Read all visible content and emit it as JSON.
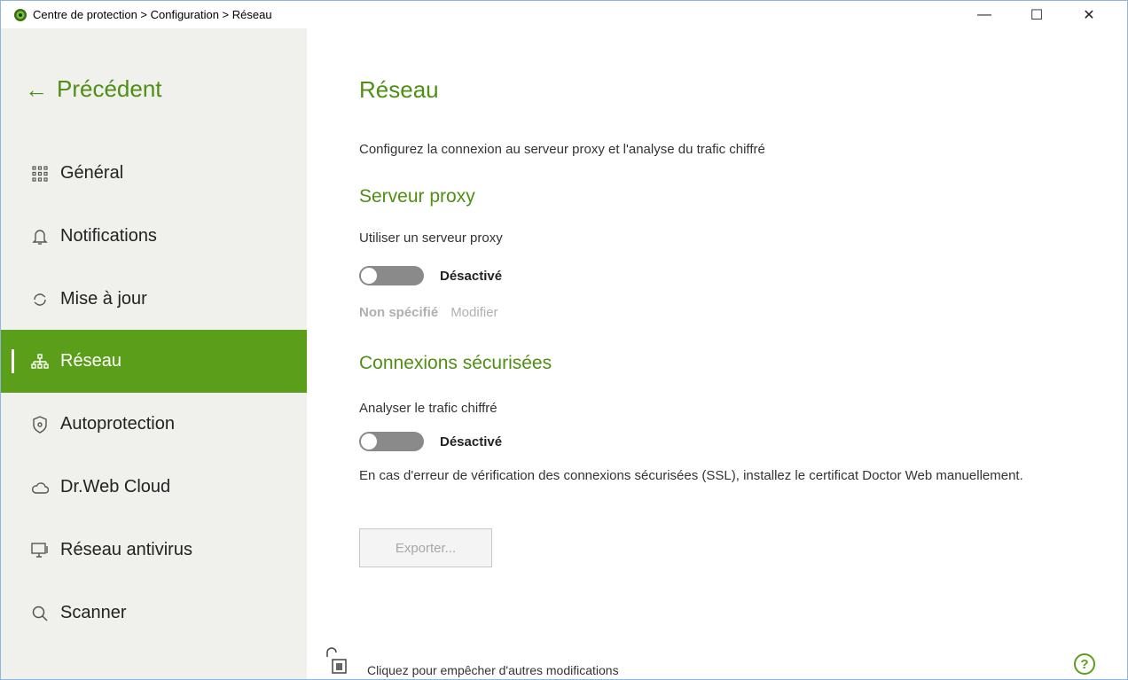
{
  "window": {
    "title": "Centre de protection > Configuration > Réseau",
    "controls": {
      "minimize": "—",
      "maximize": "☐",
      "close": "✕"
    }
  },
  "sidebar": {
    "back_label": "Précédent",
    "items": [
      {
        "label": "Général",
        "icon": "grid-icon",
        "active": false
      },
      {
        "label": "Notifications",
        "icon": "bell-icon",
        "active": false
      },
      {
        "label": "Mise à jour",
        "icon": "refresh-icon",
        "active": false
      },
      {
        "label": "Réseau",
        "icon": "network-icon",
        "active": true
      },
      {
        "label": "Autoprotection",
        "icon": "shield-icon",
        "active": false
      },
      {
        "label": "Dr.Web Cloud",
        "icon": "cloud-icon",
        "active": false
      },
      {
        "label": "Réseau antivirus",
        "icon": "monitor-icon",
        "active": false
      },
      {
        "label": "Scanner",
        "icon": "search-icon",
        "active": false
      }
    ]
  },
  "main": {
    "title": "Réseau",
    "description": "Configurez la connexion au serveur proxy et l'analyse du trafic chiffré",
    "proxy": {
      "heading": "Serveur proxy",
      "label": "Utiliser un serveur proxy",
      "toggle_state": "Désactivé",
      "value": "Non spécifié",
      "modify_link": "Modifier"
    },
    "secure": {
      "heading": "Connexions sécurisées",
      "label": "Analyser le trafic chiffré",
      "toggle_state": "Désactivé",
      "note": "En cas d'erreur de vérification des connexions sécurisées (SSL), installez le certificat Doctor Web manuellement.",
      "export_label": "Exporter..."
    },
    "footer": {
      "lock_text": "Cliquez pour empêcher d'autres modifications",
      "help": "?"
    }
  },
  "colors": {
    "accent": "#5a9e1a",
    "heading": "#4e8f14",
    "sidebar_bg": "#f0f0ec"
  }
}
